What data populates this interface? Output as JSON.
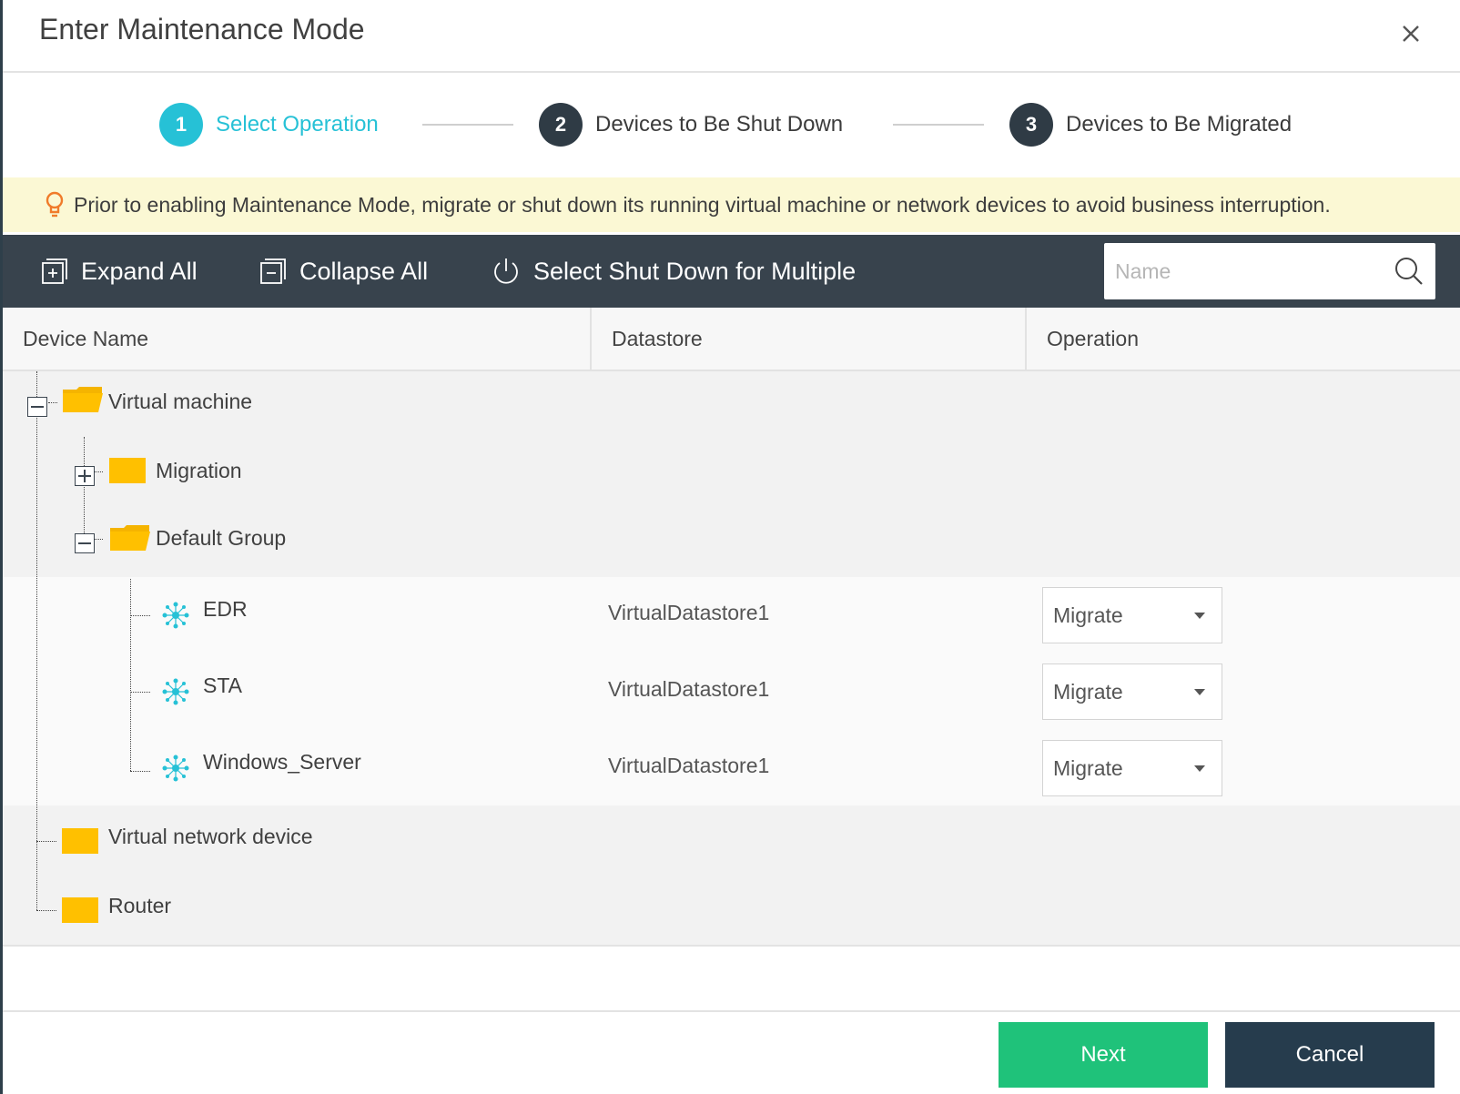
{
  "dialog": {
    "title": "Enter Maintenance Mode",
    "close_icon": "close-icon"
  },
  "steps": [
    {
      "num": "1",
      "label": "Select Operation",
      "active": true
    },
    {
      "num": "2",
      "label": "Devices to Be Shut Down",
      "active": false
    },
    {
      "num": "3",
      "label": "Devices to Be Migrated",
      "active": false
    }
  ],
  "banner": {
    "icon": "lightbulb-icon",
    "text": "Prior to enabling Maintenance Mode, migrate or shut down its running virtual machine or network devices to avoid business interruption."
  },
  "toolbar": {
    "expand_all": "Expand All",
    "collapse_all": "Collapse All",
    "shutdown_multiple": "Select Shut Down for Multiple",
    "search_placeholder": "Name",
    "search_value": ""
  },
  "table": {
    "columns": [
      "Device Name",
      "Datastore",
      "Operation"
    ],
    "tree": {
      "virtual_machine": "Virtual machine",
      "migration": "Migration",
      "default_group": "Default Group",
      "vms": [
        {
          "name": "EDR",
          "datastore": "VirtualDatastore1",
          "operation": "Migrate"
        },
        {
          "name": "STA",
          "datastore": "VirtualDatastore1",
          "operation": "Migrate"
        },
        {
          "name": "Windows_Server",
          "datastore": "VirtualDatastore1",
          "operation": "Migrate"
        }
      ],
      "virtual_network_device": "Virtual network device",
      "router": "Router"
    }
  },
  "footer": {
    "next": "Next",
    "cancel": "Cancel"
  },
  "colors": {
    "accent": "#26c1d6",
    "toolbar_bg": "#38434d",
    "next_bg": "#1fc27a",
    "cancel_bg": "#263c4d",
    "folder": "#ffc000",
    "banner_bg": "#fbf8d4"
  }
}
